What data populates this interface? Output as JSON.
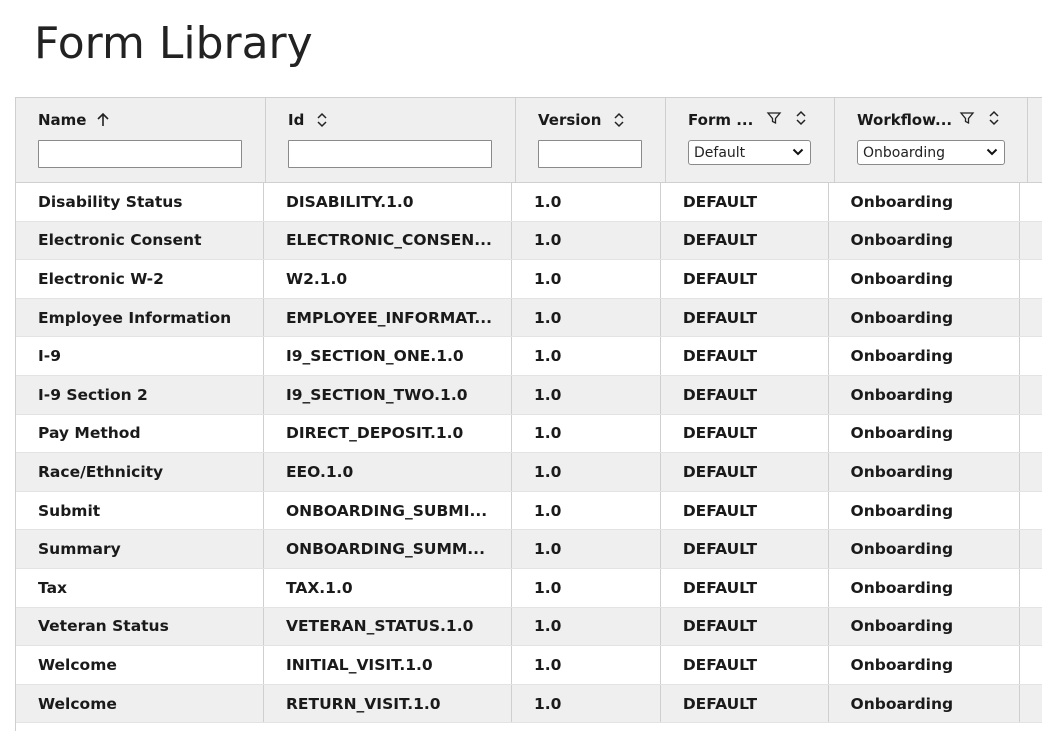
{
  "page": {
    "title": "Form Library"
  },
  "columns": {
    "name": {
      "label": "Name"
    },
    "id": {
      "label": "Id"
    },
    "version": {
      "label": "Version"
    },
    "form": {
      "label": "Form ...",
      "selected": "Default"
    },
    "workflow": {
      "label": "Workflow...",
      "selected": "Onboarding"
    }
  },
  "rows": [
    {
      "name": "Disability Status",
      "id": "DISABILITY.1.0",
      "version": "1.0",
      "form": "DEFAULT",
      "workflow": "Onboarding"
    },
    {
      "name": "Electronic Consent",
      "id": "ELECTRONIC_CONSEN...",
      "version": "1.0",
      "form": "DEFAULT",
      "workflow": "Onboarding"
    },
    {
      "name": "Electronic W-2",
      "id": "W2.1.0",
      "version": "1.0",
      "form": "DEFAULT",
      "workflow": "Onboarding"
    },
    {
      "name": "Employee Information",
      "id": "EMPLOYEE_INFORMAT...",
      "version": "1.0",
      "form": "DEFAULT",
      "workflow": "Onboarding"
    },
    {
      "name": "I-9",
      "id": "I9_SECTION_ONE.1.0",
      "version": "1.0",
      "form": "DEFAULT",
      "workflow": "Onboarding"
    },
    {
      "name": "I-9 Section 2",
      "id": "I9_SECTION_TWO.1.0",
      "version": "1.0",
      "form": "DEFAULT",
      "workflow": "Onboarding"
    },
    {
      "name": "Pay Method",
      "id": "DIRECT_DEPOSIT.1.0",
      "version": "1.0",
      "form": "DEFAULT",
      "workflow": "Onboarding"
    },
    {
      "name": "Race/Ethnicity",
      "id": "EEO.1.0",
      "version": "1.0",
      "form": "DEFAULT",
      "workflow": "Onboarding"
    },
    {
      "name": "Submit",
      "id": "ONBOARDING_SUBMI...",
      "version": "1.0",
      "form": "DEFAULT",
      "workflow": "Onboarding"
    },
    {
      "name": "Summary",
      "id": "ONBOARDING_SUMM...",
      "version": "1.0",
      "form": "DEFAULT",
      "workflow": "Onboarding"
    },
    {
      "name": "Tax",
      "id": "TAX.1.0",
      "version": "1.0",
      "form": "DEFAULT",
      "workflow": "Onboarding"
    },
    {
      "name": "Veteran Status",
      "id": "VETERAN_STATUS.1.0",
      "version": "1.0",
      "form": "DEFAULT",
      "workflow": "Onboarding"
    },
    {
      "name": "Welcome",
      "id": "INITIAL_VISIT.1.0",
      "version": "1.0",
      "form": "DEFAULT",
      "workflow": "Onboarding"
    },
    {
      "name": "Welcome",
      "id": "RETURN_VISIT.1.0",
      "version": "1.0",
      "form": "DEFAULT",
      "workflow": "Onboarding"
    }
  ],
  "icons": {
    "name_sort": "arrow-up-icon",
    "id_sort": "sort-updown-icon",
    "version_sort": "sort-updown-icon",
    "form_filter": "filter-icon",
    "form_sort": "sort-updown-icon",
    "workflow_filter": "filter-icon",
    "workflow_sort": "sort-updown-icon",
    "select_caret": "chevron-down-icon"
  }
}
